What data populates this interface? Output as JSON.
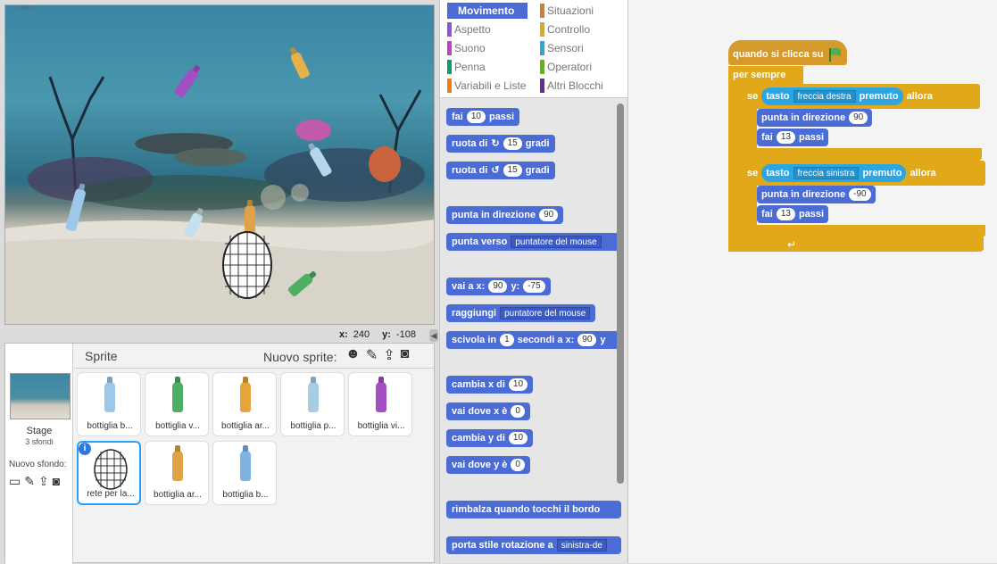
{
  "stage": {
    "version": "v461",
    "x_label": "x:",
    "x_value": "240",
    "y_label": "y:",
    "y_value": "-108"
  },
  "sprites_pane": {
    "title": "Sprite",
    "new_sprite_label": "Nuovo sprite:",
    "stage_label": "Stage",
    "stage_backdrops": "3 sfondi",
    "new_backdrop_label": "Nuovo sfondo:",
    "sprites": [
      {
        "label": "bottiglia b...",
        "color": "#9cc8ea"
      },
      {
        "label": "bottiglia v...",
        "color": "#4caf62"
      },
      {
        "label": "bottiglia ar...",
        "color": "#e6a43a"
      },
      {
        "label": "bottiglia  p...",
        "color": "#a8cde3"
      },
      {
        "label": "bottiglia vi...",
        "color": "#a24fc4"
      },
      {
        "label": "rete per la...",
        "color": "#333333"
      },
      {
        "label": "bottiglia ar...",
        "color": "#e0a246"
      },
      {
        "label": "bottiglia b...",
        "color": "#7fb2de"
      }
    ]
  },
  "categories": {
    "left": [
      {
        "label": "Movimento",
        "color": "#4a6cd4",
        "active": true
      },
      {
        "label": "Aspetto",
        "color": "#8a55d7"
      },
      {
        "label": "Suono",
        "color": "#bb42c3"
      },
      {
        "label": "Penna",
        "color": "#0e9a6c"
      },
      {
        "label": "Variabili e Liste",
        "color": "#ee7d16"
      }
    ],
    "right": [
      {
        "label": "Situazioni",
        "color": "#c88330"
      },
      {
        "label": "Controllo",
        "color": "#e1a91a"
      },
      {
        "label": "Sensori",
        "color": "#2ca5e2"
      },
      {
        "label": "Operatori",
        "color": "#5cb712"
      },
      {
        "label": "Altri Blocchi",
        "color": "#632d99"
      }
    ]
  },
  "palette": {
    "move_prefix": "fai",
    "move_value": "10",
    "move_suffix": "passi",
    "turn_right_prefix": "ruota di",
    "turn_right_value": "15",
    "turn_right_suffix": "gradi",
    "turn_left_prefix": "ruota di",
    "turn_left_value": "15",
    "turn_left_suffix": "gradi",
    "point_dir_prefix": "punta in direzione",
    "point_dir_value": "90",
    "point_towards_prefix": "punta verso",
    "point_towards_value": "puntatore del mouse",
    "goto_xy_prefix": "vai a x:",
    "goto_xy_x": "90",
    "goto_xy_y_label": "y:",
    "goto_xy_y": "-75",
    "goto_prefix": "raggiungi",
    "goto_value": "puntatore del mouse",
    "glide_prefix": "scivola in",
    "glide_secs": "1",
    "glide_mid": "secondi a x:",
    "glide_x": "90",
    "glide_y_label": "y",
    "change_x_prefix": "cambia x di",
    "change_x_value": "10",
    "set_x_prefix": "vai dove x è",
    "set_x_value": "0",
    "change_y_prefix": "cambia y di",
    "change_y_value": "10",
    "set_y_prefix": "vai dove y è",
    "set_y_value": "0",
    "bounce": "rimbalza quando tocchi il bordo",
    "rotation_prefix": "porta stile rotazione a",
    "rotation_value": "sinistra-de"
  },
  "script": {
    "hat": "quando si clicca su",
    "forever": "per sempre",
    "if1_label": "se",
    "if1_key_prefix": "tasto",
    "if1_key": "freccia destra",
    "if1_key_suffix": "premuto",
    "if1_then": "allora",
    "if1_dir_prefix": "punta in direzione",
    "if1_dir_value": "90",
    "if1_move_prefix": "fai",
    "if1_move_value": "13",
    "if1_move_suffix": "passi",
    "if2_label": "se",
    "if2_key_prefix": "tasto",
    "if2_key": "freccia sinistra",
    "if2_key_suffix": "premuto",
    "if2_then": "allora",
    "if2_dir_prefix": "punta in direzione",
    "if2_dir_value": "-90",
    "if2_move_prefix": "fai",
    "if2_move_value": "13",
    "if2_move_suffix": "passi"
  }
}
